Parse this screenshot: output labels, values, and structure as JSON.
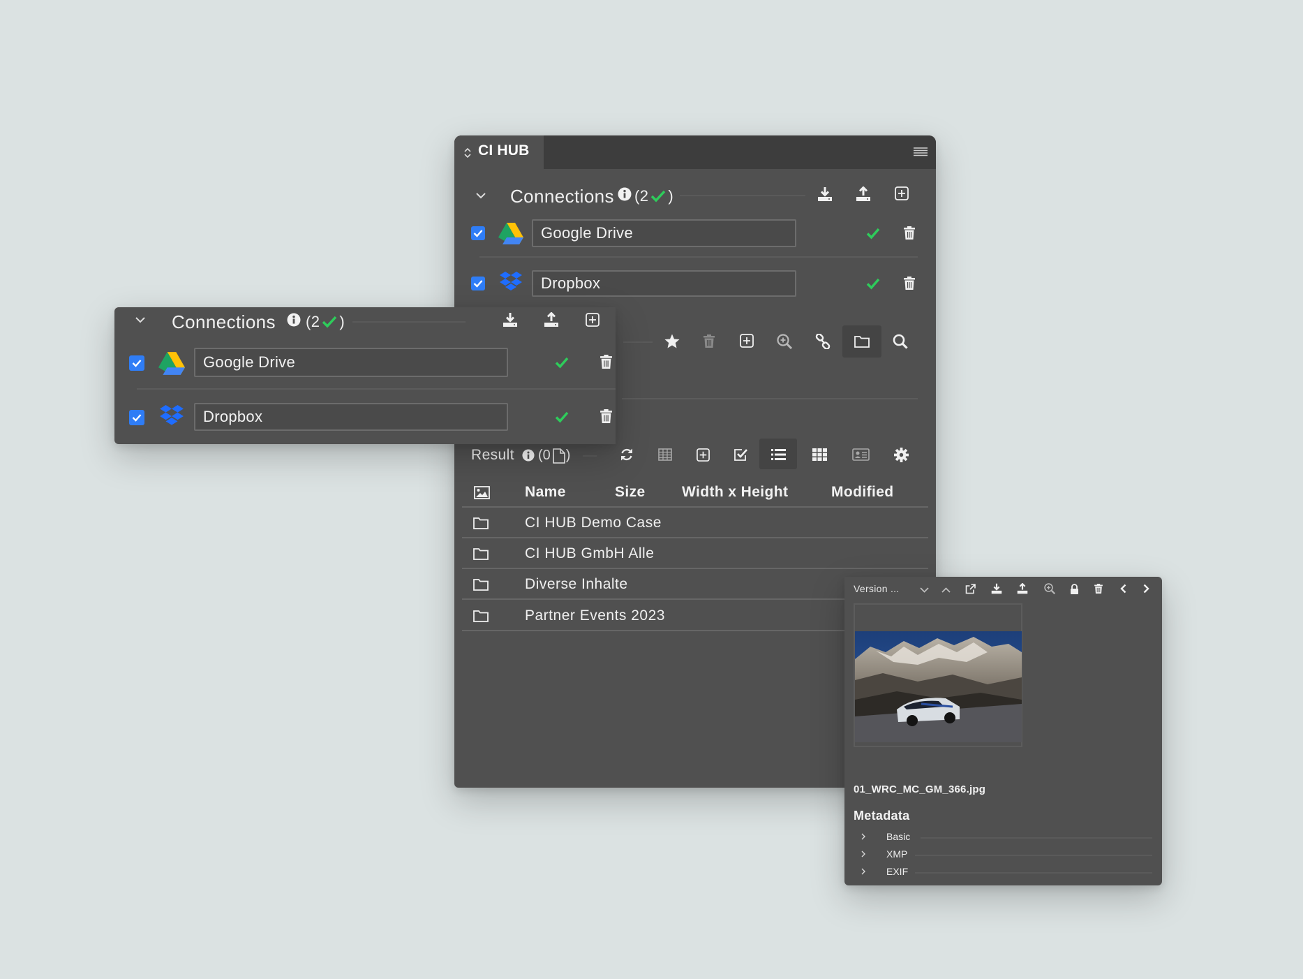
{
  "app": {
    "title": "CI HUB"
  },
  "connections": {
    "label": "Connections",
    "count_prefix": "(2",
    "count_suffix": ")",
    "items": [
      {
        "name": "Google Drive",
        "service": "google-drive"
      },
      {
        "name": "Dropbox",
        "service": "dropbox"
      }
    ]
  },
  "result": {
    "label": "Result",
    "count_prefix": "(0",
    "count_suffix": ")",
    "columns": [
      "Name",
      "Size",
      "Width x Height",
      "Modified"
    ],
    "rows": [
      {
        "name": "CI HUB Demo Case"
      },
      {
        "name": "CI HUB GmbH Alle"
      },
      {
        "name": "Diverse Inhalte"
      },
      {
        "name": "Partner Events 2023"
      }
    ]
  },
  "preview": {
    "version_label": "Version ...",
    "filename": "01_WRC_MC_GM_366.jpg",
    "metadata_title": "Metadata",
    "metadata_sections": [
      "Basic",
      "XMP",
      "EXIF"
    ]
  },
  "colors": {
    "background": "#dbe2e2",
    "panel": "#505050",
    "checkbox": "#2f7df6",
    "success": "#2ecc5b"
  }
}
